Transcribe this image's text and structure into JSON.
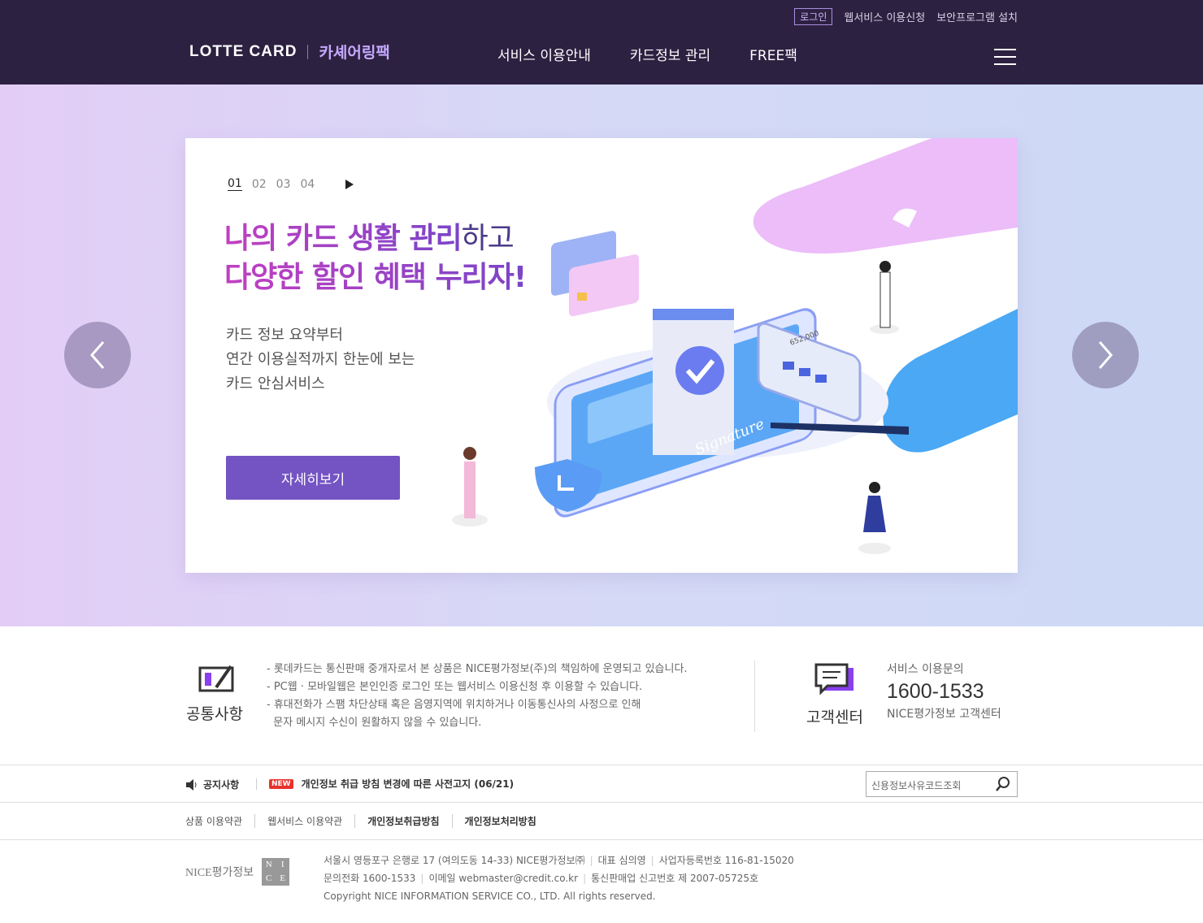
{
  "header": {
    "util": {
      "login": "로그인",
      "web_apply": "웹서비스 이용신청",
      "security": "보안프로그램 설치"
    },
    "logo": {
      "brand": "LOTTE CARD",
      "service": "카셰어링팩"
    },
    "gnb": [
      "서비스 이용안내",
      "카드정보 관리",
      "FREE팩"
    ]
  },
  "visual": {
    "pager": [
      "01",
      "02",
      "03",
      "04"
    ],
    "headline_1a": "나의 카드 생활 관리",
    "headline_1b": "하고",
    "headline_2a": "다양한 할인 혜택 누리자!",
    "desc": [
      "카드 정보 요약부터",
      "연간 이용실적까지 한눈에 보는",
      "카드 안심서비스"
    ],
    "button": "자세히보기",
    "illu_text": {
      "amount": "652,000",
      "sign": "Signature"
    }
  },
  "notice": {
    "title": "공통사항",
    "items": [
      "- 롯데카드는 통신판매 중개자로서 본 상품은 NICE평가정보(주)의 책임하에 운영되고 있습니다.",
      "- PC웹 · 모바일웹은 본인인증 로그인 또는 웹서비스 이용신청 후 이용할 수 있습니다.",
      "- 휴대전화가 스팸 차단상태 혹은 음영지역에 위치하거나 이동통신사의 사정으로 인해",
      "  문자 메시지 수신이 원활하지 않을 수 있습니다."
    ]
  },
  "cs": {
    "title": "고객센터",
    "inquiry": "서비스 이용문의",
    "phone": "1600-1533",
    "center": "NICE평가정보 고객센터"
  },
  "board": {
    "label": "공지사항",
    "badge": "NEW",
    "headline": "개인정보 취급 방침 변경에 따른 사전고지 (06/21)",
    "search_placeholder": "신용정보사유코드조회"
  },
  "terms": [
    "상품 이용약관",
    "웹서비스 이용약관",
    "개인정보취급방침",
    "개인정보처리방침"
  ],
  "footer": {
    "logo_text": "NICE평가정보",
    "box": [
      "N",
      "I",
      "C",
      "E"
    ],
    "line1": [
      "서울시 영등포구 은행로 17 (여의도동 14-33) NICE평가정보㈜",
      "대표 심의영",
      "사업자등록번호 116-81-15020"
    ],
    "line2": [
      "문의전화 1600-1533",
      "이메일 webmaster@credit.co.kr",
      "통신판매업 신고번호 제 2007-05725호"
    ],
    "copyright": "Copyright NICE INFORMATION SERVICE CO., LTD. All rights reserved."
  },
  "colors": {
    "header_bg": "#2d2141",
    "accent": "#7453c3",
    "new_badge": "#e8322d"
  }
}
